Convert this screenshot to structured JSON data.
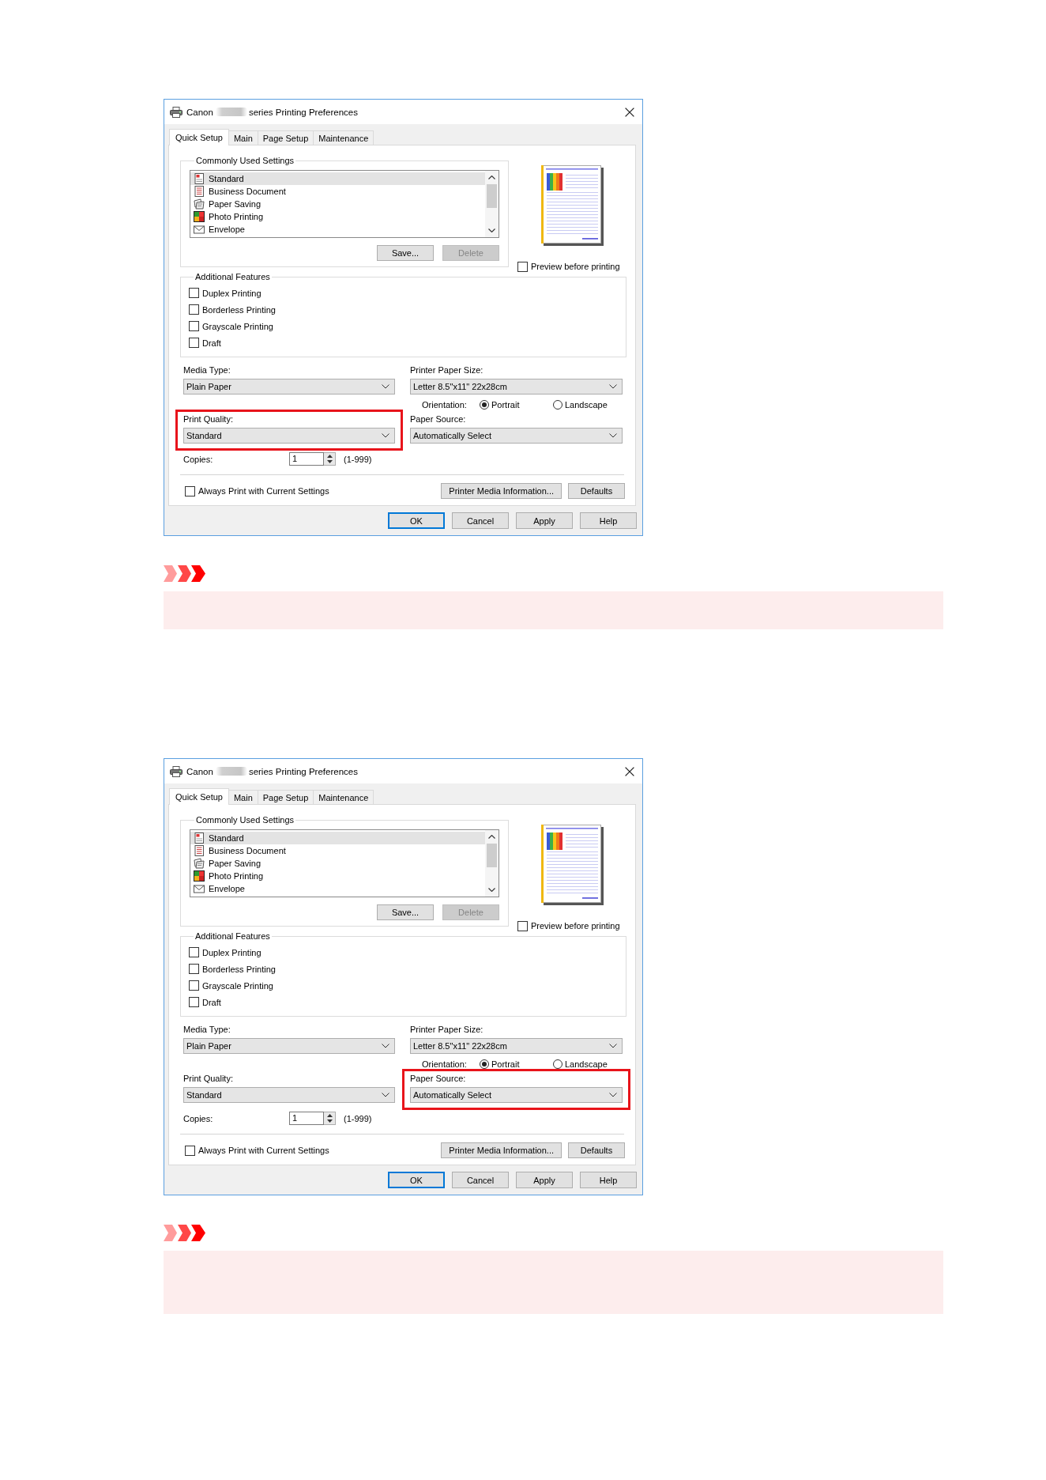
{
  "figures": [
    {
      "dialog": {
        "title_start": "Canon",
        "title_end": "series Printing Preferences",
        "tabs": [
          {
            "label": "Quick Setup",
            "selected": true
          },
          {
            "label": "Main",
            "selected": false
          },
          {
            "label": "Page Setup",
            "selected": false
          },
          {
            "label": "Maintenance",
            "selected": false
          }
        ],
        "commonly_used_settings": {
          "label": "Commonly Used Settings",
          "items": [
            {
              "label": "Standard",
              "kind": "standard",
              "selected": true
            },
            {
              "label": "Business Document",
              "kind": "business",
              "selected": false
            },
            {
              "label": "Paper Saving",
              "kind": "saving",
              "selected": false
            },
            {
              "label": "Photo Printing",
              "kind": "photo",
              "selected": false
            },
            {
              "label": "Envelope",
              "kind": "envelope",
              "selected": false
            }
          ],
          "buttons": [
            {
              "label": "Save...",
              "disabled": false
            },
            {
              "label": "Delete",
              "disabled": true
            }
          ]
        },
        "preview_before_printing": {
          "label": "Preview before printing",
          "checked": false
        },
        "additional_features": {
          "label": "Additional Features",
          "options": [
            {
              "label": "Duplex Printing",
              "checked": false
            },
            {
              "label": "Borderless Printing",
              "checked": false
            },
            {
              "label": "Grayscale Printing",
              "checked": false
            },
            {
              "label": "Draft",
              "checked": false
            }
          ]
        },
        "media_type": {
          "label": "Media Type:",
          "value": "Plain Paper",
          "highlighted": false
        },
        "printer_paper_size": {
          "label": "Printer Paper Size:",
          "value": "Letter 8.5\"x11\" 22x28cm",
          "highlighted": false
        },
        "orientation": {
          "label": "Orientation:",
          "options": [
            {
              "label": "Portrait",
              "selected": true
            },
            {
              "label": "Landscape",
              "selected": false
            }
          ]
        },
        "print_quality": {
          "label": "Print Quality:",
          "value": "Standard",
          "highlighted": true
        },
        "paper_source": {
          "label": "Paper Source:",
          "value": "Automatically Select",
          "highlighted": false
        },
        "copies": {
          "label": "Copies:",
          "value": "1",
          "range": "(1-999)"
        },
        "always_print_with_current_settings": {
          "label": "Always Print with Current Settings",
          "checked": false
        },
        "panel_buttons": [
          {
            "label": "Printer Media Information..."
          },
          {
            "label": "Defaults"
          }
        ],
        "footer_buttons": [
          {
            "label": "OK",
            "default": true
          },
          {
            "label": "Cancel",
            "default": false
          },
          {
            "label": "Apply",
            "default": false
          },
          {
            "label": "Help",
            "default": false
          }
        ]
      }
    },
    {
      "dialog": {
        "title_start": "Canon",
        "title_end": "series Printing Preferences",
        "tabs": [
          {
            "label": "Quick Setup",
            "selected": true
          },
          {
            "label": "Main",
            "selected": false
          },
          {
            "label": "Page Setup",
            "selected": false
          },
          {
            "label": "Maintenance",
            "selected": false
          }
        ],
        "commonly_used_settings": {
          "label": "Commonly Used Settings",
          "items": [
            {
              "label": "Standard",
              "kind": "standard",
              "selected": true
            },
            {
              "label": "Business Document",
              "kind": "business",
              "selected": false
            },
            {
              "label": "Paper Saving",
              "kind": "saving",
              "selected": false
            },
            {
              "label": "Photo Printing",
              "kind": "photo",
              "selected": false
            },
            {
              "label": "Envelope",
              "kind": "envelope",
              "selected": false
            }
          ],
          "buttons": [
            {
              "label": "Save...",
              "disabled": false
            },
            {
              "label": "Delete",
              "disabled": true
            }
          ]
        },
        "preview_before_printing": {
          "label": "Preview before printing",
          "checked": false
        },
        "additional_features": {
          "label": "Additional Features",
          "options": [
            {
              "label": "Duplex Printing",
              "checked": false
            },
            {
              "label": "Borderless Printing",
              "checked": false
            },
            {
              "label": "Grayscale Printing",
              "checked": false
            },
            {
              "label": "Draft",
              "checked": false
            }
          ]
        },
        "media_type": {
          "label": "Media Type:",
          "value": "Plain Paper",
          "highlighted": false
        },
        "printer_paper_size": {
          "label": "Printer Paper Size:",
          "value": "Letter 8.5\"x11\" 22x28cm",
          "highlighted": false
        },
        "orientation": {
          "label": "Orientation:",
          "options": [
            {
              "label": "Portrait",
              "selected": true
            },
            {
              "label": "Landscape",
              "selected": false
            }
          ]
        },
        "print_quality": {
          "label": "Print Quality:",
          "value": "Standard",
          "highlighted": false
        },
        "paper_source": {
          "label": "Paper Source:",
          "value": "Automatically Select",
          "highlighted": true
        },
        "copies": {
          "label": "Copies:",
          "value": "1",
          "range": "(1-999)"
        },
        "always_print_with_current_settings": {
          "label": "Always Print with Current Settings",
          "checked": false
        },
        "panel_buttons": [
          {
            "label": "Printer Media Information..."
          },
          {
            "label": "Defaults"
          }
        ],
        "footer_buttons": [
          {
            "label": "OK",
            "default": true
          },
          {
            "label": "Cancel",
            "default": false
          },
          {
            "label": "Apply",
            "default": false
          },
          {
            "label": "Help",
            "default": false
          }
        ]
      }
    }
  ]
}
